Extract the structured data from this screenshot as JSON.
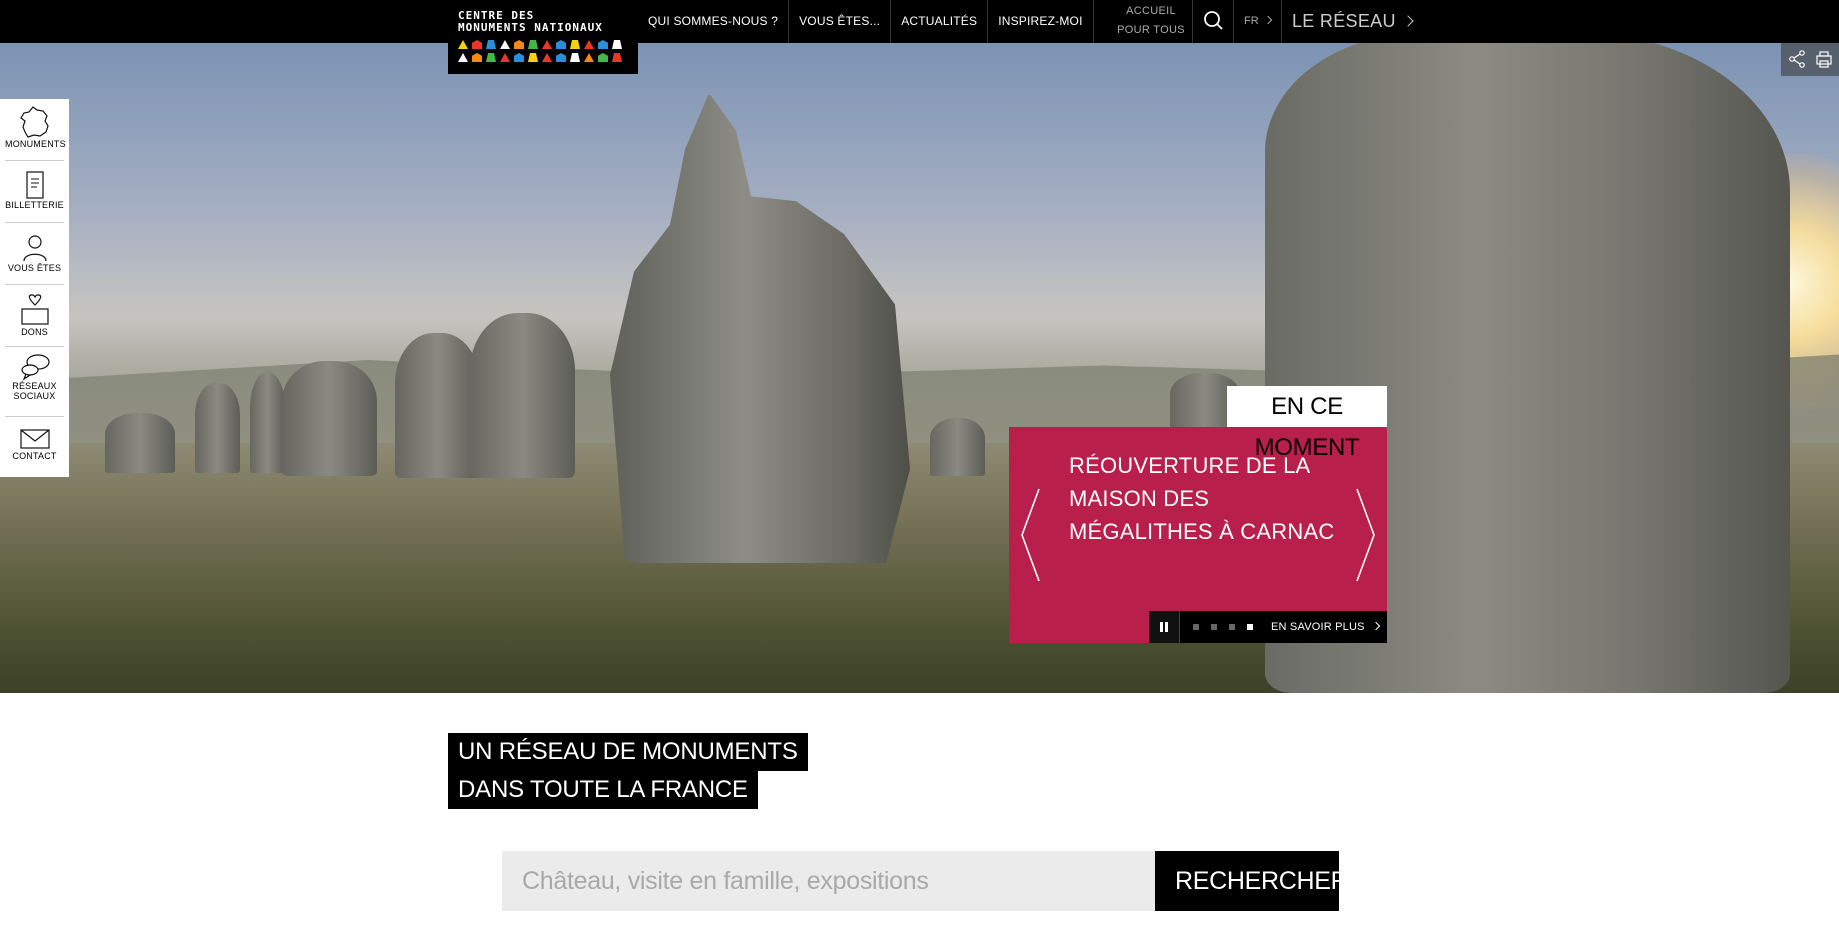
{
  "logo": {
    "line1": "CENTRE DES",
    "line2": "MONUMENTS NATIONAUX",
    "icon_colors": [
      "#f5d40f",
      "#e8362a",
      "#2a8fd6",
      "#fff",
      "#f08a1c",
      "#45b649",
      "#e8362a",
      "#2a8fd6"
    ]
  },
  "nav": {
    "items": [
      "QUI SOMMES-NOUS ?",
      "VOUS ÊTES...",
      "ACTUALITÉS",
      "INSPIREZ-MOI"
    ],
    "accueil_line1": "ACCUEIL",
    "accueil_line2": "POUR TOUS",
    "lang": "FR",
    "reseau": "LE RÉSEAU"
  },
  "sidebar": {
    "items": [
      {
        "label": "MONUMENTS",
        "icon": "france-map-icon"
      },
      {
        "label": "BILLETTERIE",
        "icon": "ticket-icon"
      },
      {
        "label": "VOUS ÊTES",
        "icon": "user-icon"
      },
      {
        "label": "DONS",
        "icon": "heart-box-icon"
      },
      {
        "label": "RÉSEAUX SOCIAUX",
        "label_l1": "RÉSEAUX",
        "label_l2": "SOCIAUX",
        "icon": "chat-bubbles-icon"
      },
      {
        "label": "CONTACT",
        "icon": "envelope-icon"
      }
    ]
  },
  "hero": {
    "tag": "EN CE MOMENT",
    "title": "RÉOUVERTURE DE LA MAISON DES MÉGALITHES À CARNAC",
    "cta": "EN SAVOIR PLUS",
    "slides_total": 4,
    "slide_active": 4,
    "accent_color": "#b81f4a"
  },
  "section": {
    "title_line1": "UN RÉSEAU DE MONUMENTS",
    "title_line2": "DANS TOUTE LA FRANCE"
  },
  "search": {
    "placeholder": "Château, visite en famille, expositions",
    "value": "",
    "button": "RECHERCHER"
  }
}
